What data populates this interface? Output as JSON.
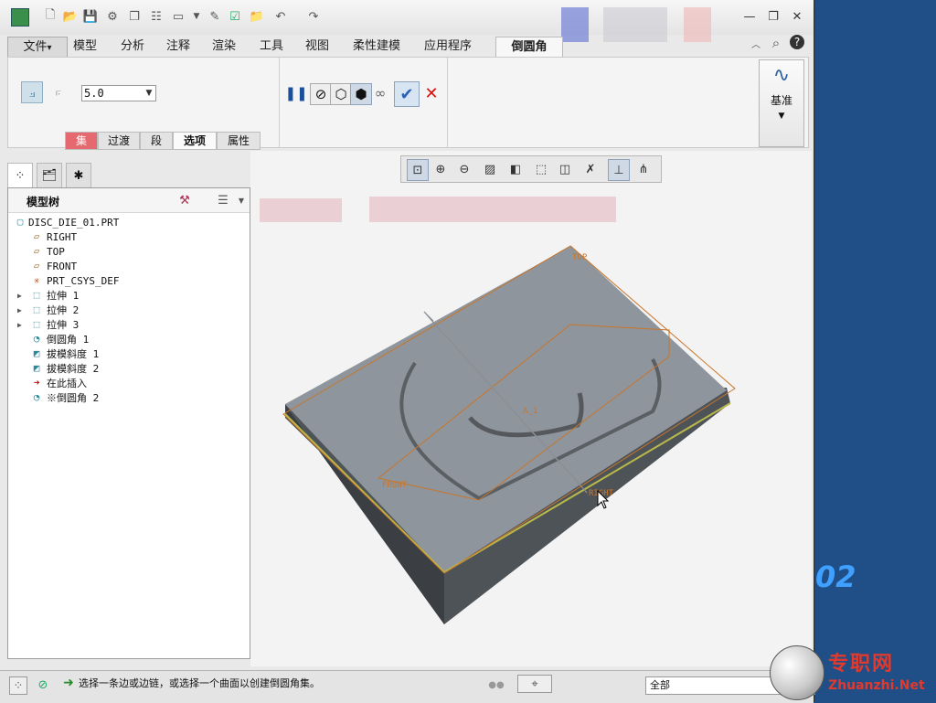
{
  "quick_access": {
    "icons": [
      "app-icon",
      "new-icon",
      "open-icon",
      "save-icon",
      "regenerate-icon",
      "copy-icon",
      "settings-icon",
      "window-icon",
      "dropdown-icon",
      "paste-icon",
      "check-icon",
      "folder-icon",
      "undo-icon",
      "redo-icon"
    ],
    "window_controls": [
      "minimize-icon",
      "restore-icon",
      "close-icon"
    ]
  },
  "ribbon": {
    "tabs": [
      "文件",
      "模型",
      "分析",
      "注释",
      "渲染",
      "工具",
      "视图",
      "柔性建模",
      "应用程序",
      "倒圆角"
    ],
    "file_arrow": "▾",
    "right_icons": [
      "collapse-icon",
      "search-icon",
      "help-icon"
    ],
    "round_value": "5.0",
    "subtabs": [
      "集",
      "过渡",
      "段",
      "选项",
      "属性"
    ],
    "datum_label": "基准"
  },
  "view_toolbar": [
    "refit-icon",
    "zoom-in-icon",
    "zoom-out-icon",
    "repaint-icon",
    "display-style-icon",
    "view-orient-icon",
    "saved-views-icon",
    "plane-display-icon",
    "annotation-icon",
    "csys-icon"
  ],
  "model_tree": {
    "title": "模型树",
    "items": [
      {
        "label": "DISC_DIE_01.PRT",
        "icon": "part-icon",
        "indent": 0,
        "expand": false
      },
      {
        "label": "RIGHT",
        "icon": "datum-plane-icon",
        "indent": 1,
        "expand": false
      },
      {
        "label": "TOP",
        "icon": "datum-plane-icon",
        "indent": 1,
        "expand": false
      },
      {
        "label": "FRONT",
        "icon": "datum-plane-icon",
        "indent": 1,
        "expand": false
      },
      {
        "label": "PRT_CSYS_DEF",
        "icon": "csys-icon",
        "indent": 1,
        "expand": false
      },
      {
        "label": "拉伸 1",
        "icon": "extrude-icon",
        "indent": 1,
        "expand": true
      },
      {
        "label": "拉伸 2",
        "icon": "extrude-icon",
        "indent": 1,
        "expand": true
      },
      {
        "label": "拉伸 3",
        "icon": "extrude-icon",
        "indent": 1,
        "expand": true
      },
      {
        "label": "倒圆角 1",
        "icon": "round-icon",
        "indent": 1,
        "expand": false
      },
      {
        "label": "拔模斜度 1",
        "icon": "draft-icon",
        "indent": 1,
        "expand": false
      },
      {
        "label": "拔模斜度 2",
        "icon": "draft-icon",
        "indent": 1,
        "expand": false
      },
      {
        "label": "在此插入",
        "icon": "insert-arrow-icon",
        "indent": 1,
        "expand": false
      },
      {
        "label": "※倒圆角 2",
        "icon": "round-icon",
        "indent": 1,
        "expand": false
      }
    ]
  },
  "graphics": {
    "datum_labels": {
      "top": "TOP",
      "right": "RIGHT",
      "front": "FRONT",
      "axis": "A_1"
    }
  },
  "status": {
    "message": "选择一条边或边链，或选择一个曲面以创建倒圆角集。",
    "filter": "全部"
  },
  "watermark": {
    "number": "02",
    "site_name": "专职网",
    "url": "Zhuanzhi.Net"
  },
  "colors": {
    "accent_set_tab": "#e46a6f",
    "model_top": "#8f959c",
    "model_side": "#4e5358",
    "datum_orange": "#c8762a",
    "desktop_blue": "#1f4f86"
  }
}
